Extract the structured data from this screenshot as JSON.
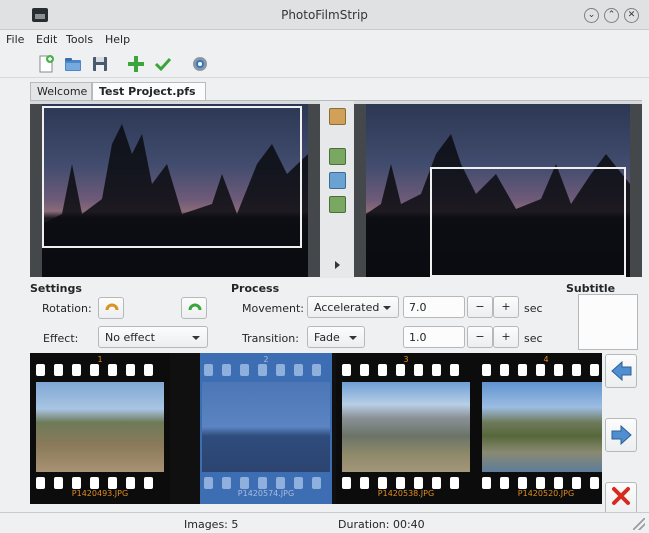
{
  "window": {
    "title": "PhotoFilmStrip"
  },
  "menu": [
    "File",
    "Edit",
    "Tools",
    "Help"
  ],
  "toolbar": [
    {
      "name": "new-project",
      "icon": "new-document-icon"
    },
    {
      "name": "open-project",
      "icon": "open-folder-icon"
    },
    {
      "name": "save-project",
      "icon": "floppy-disk-icon"
    },
    {
      "name": "add-pictures",
      "icon": "plus-icon"
    },
    {
      "name": "render",
      "icon": "checkmark-icon"
    },
    {
      "name": "settings",
      "icon": "gear-icon"
    }
  ],
  "tabs": [
    {
      "label": "Welcome",
      "active": false,
      "closable": false
    },
    {
      "label": "Test Project.pfs",
      "active": true,
      "closable": true
    }
  ],
  "settings": {
    "heading": "Settings",
    "rotation_label": "Rotation:",
    "effect_label": "Effect:",
    "effect_value": "No effect"
  },
  "process": {
    "heading": "Process",
    "movement_label": "Movement:",
    "movement_value": "Accelerated",
    "movement_duration": "7.0",
    "transition_label": "Transition:",
    "transition_value": "Fade",
    "transition_duration": "1.0",
    "minus": "−",
    "plus": "+",
    "unit": "sec"
  },
  "subtitle": {
    "heading": "Subtitle"
  },
  "filmstrip": [
    {
      "number": "1",
      "filename": "P1420493.JPG",
      "selected": false
    },
    {
      "number": "2",
      "filename": "P1420574.JPG",
      "selected": true
    },
    {
      "number": "3",
      "filename": "P1420538.JPG",
      "selected": false
    },
    {
      "number": "4",
      "filename": "P1420520.JPG",
      "selected": false
    }
  ],
  "side_buttons": [
    {
      "name": "move-left",
      "icon": "arrow-left-icon"
    },
    {
      "name": "move-right",
      "icon": "arrow-right-icon"
    },
    {
      "name": "remove",
      "icon": "delete-x-icon"
    }
  ],
  "status": {
    "images": "Images: 5",
    "duration": "Duration: 00:40"
  }
}
